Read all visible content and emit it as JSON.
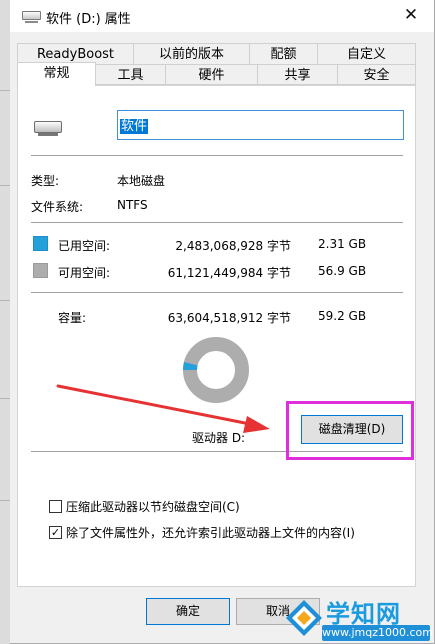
{
  "window": {
    "title": "软件 (D:) 属性",
    "close_symbol": "✕"
  },
  "tabs": {
    "back_row": [
      "ReadyBoost",
      "以前的版本",
      "配额",
      "自定义"
    ],
    "front_row": [
      "常规",
      "工具",
      "硬件",
      "共享",
      "安全"
    ],
    "active": "常规"
  },
  "general": {
    "name_value": "软件",
    "type_label": "类型:",
    "type_value": "本地磁盘",
    "fs_label": "文件系统:",
    "fs_value": "NTFS",
    "used_label": "已用空间:",
    "used_bytes": "2,483,068,928 字节",
    "used_size": "2.31 GB",
    "free_label": "可用空间:",
    "free_bytes": "61,121,449,984 字节",
    "free_size": "56.9 GB",
    "capacity_label": "容量:",
    "capacity_bytes": "63,604,518,912 字节",
    "capacity_size": "59.2 GB",
    "used_fraction": 0.039,
    "drive_label": "驱动器 D:",
    "cleanup_button": "磁盘清理(D)",
    "compress_label": "压缩此驱动器以节约磁盘空间(C)",
    "compress_checked": false,
    "index_label": "除了文件属性外，还允许索引此驱动器上文件的内容(I)",
    "index_checked": true
  },
  "colors": {
    "used": "#26a0da",
    "free": "#adadad",
    "highlight": "#e02ddd",
    "arrow": "#e63232",
    "accent": "#0078d7"
  },
  "buttons": {
    "ok": "确定",
    "cancel": "取消"
  },
  "watermark": {
    "title": "学知网",
    "url": "www.jmqz1000.com"
  }
}
